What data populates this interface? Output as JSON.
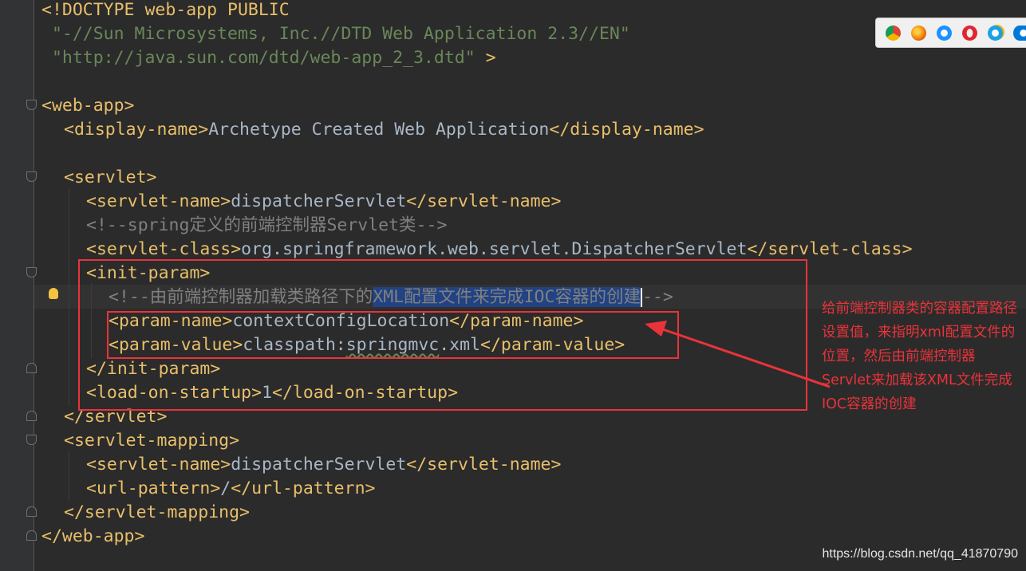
{
  "editor": {
    "lines": [
      {
        "n": 0,
        "indent": 0,
        "parts": [
          {
            "k": "t",
            "v": "<!DOCTYPE web-app PUBLIC"
          }
        ]
      },
      {
        "n": 1,
        "indent": 0,
        "parts": [
          {
            "k": "s",
            "v": " \"-//Sun Microsystems, Inc.//DTD Web Application 2.3//EN\""
          }
        ]
      },
      {
        "n": 2,
        "indent": 0,
        "parts": [
          {
            "k": "s",
            "v": " \"http://java.sun.com/dtd/web-app_2_3.dtd\""
          },
          {
            "k": "t",
            "v": " >"
          }
        ]
      },
      {
        "n": 4,
        "indent": 0,
        "parts": [
          {
            "k": "t",
            "v": "<web-app>"
          }
        ]
      },
      {
        "n": 5,
        "indent": 1,
        "parts": [
          {
            "k": "t",
            "v": "<display-name>"
          },
          {
            "k": "x",
            "v": "Archetype Created Web Application"
          },
          {
            "k": "t",
            "v": "</display-name>"
          }
        ]
      },
      {
        "n": 7,
        "indent": 1,
        "parts": [
          {
            "k": "t",
            "v": "<servlet>"
          }
        ]
      },
      {
        "n": 8,
        "indent": 2,
        "parts": [
          {
            "k": "t",
            "v": "<servlet-name>"
          },
          {
            "k": "x",
            "v": "dispatcherServlet"
          },
          {
            "k": "t",
            "v": "</servlet-name>"
          }
        ]
      },
      {
        "n": 9,
        "indent": 2,
        "parts": [
          {
            "k": "c",
            "v": "<!--spring定义的前端控制器Servlet类-->"
          }
        ]
      },
      {
        "n": 10,
        "indent": 2,
        "parts": [
          {
            "k": "t",
            "v": "<servlet-class>"
          },
          {
            "k": "x",
            "v": "org.springframework.web.servlet.DispatcherServlet"
          },
          {
            "k": "t",
            "v": "</servlet-class>"
          }
        ]
      },
      {
        "n": 11,
        "indent": 2,
        "parts": [
          {
            "k": "t",
            "v": "<init-param>"
          }
        ]
      },
      {
        "n": 12,
        "indent": 3,
        "parts": [
          {
            "k": "c",
            "v": "<!--由前端控制器加载类路径下的"
          },
          {
            "k": "h",
            "v": "XML配置文件来完成IOC容器的创建"
          },
          {
            "k": "caret",
            "v": ""
          },
          {
            "k": "c",
            "v": "-->"
          }
        ]
      },
      {
        "n": 13,
        "indent": 3,
        "parts": [
          {
            "k": "t",
            "v": "<param-name>"
          },
          {
            "k": "x",
            "v": "contextConfigLocation"
          },
          {
            "k": "t",
            "v": "</param-name>"
          }
        ]
      },
      {
        "n": 14,
        "indent": 3,
        "parts": [
          {
            "k": "t",
            "v": "<param-value>"
          },
          {
            "k": "x",
            "v": "classpath:"
          },
          {
            "k": "sq",
            "v": "springmvc"
          },
          {
            "k": "x",
            "v": ".xml"
          },
          {
            "k": "t",
            "v": "</param-value>"
          }
        ]
      },
      {
        "n": 15,
        "indent": 2,
        "parts": [
          {
            "k": "t",
            "v": "</init-param>"
          }
        ]
      },
      {
        "n": 16,
        "indent": 2,
        "parts": [
          {
            "k": "t",
            "v": "<load-on-startup>"
          },
          {
            "k": "x",
            "v": "1"
          },
          {
            "k": "t",
            "v": "</load-on-startup>"
          }
        ]
      },
      {
        "n": 17,
        "indent": 1,
        "parts": [
          {
            "k": "t",
            "v": "</servlet>"
          }
        ]
      },
      {
        "n": 18,
        "indent": 1,
        "parts": [
          {
            "k": "t",
            "v": "<servlet-mapping>"
          }
        ]
      },
      {
        "n": 19,
        "indent": 2,
        "parts": [
          {
            "k": "t",
            "v": "<servlet-name>"
          },
          {
            "k": "x",
            "v": "dispatcherServlet"
          },
          {
            "k": "t",
            "v": "</servlet-name>"
          }
        ]
      },
      {
        "n": 20,
        "indent": 2,
        "parts": [
          {
            "k": "t",
            "v": "<url-pattern>"
          },
          {
            "k": "x",
            "v": "/"
          },
          {
            "k": "t",
            "v": "</url-pattern>"
          }
        ]
      },
      {
        "n": 21,
        "indent": 1,
        "parts": [
          {
            "k": "t",
            "v": "</servlet-mapping>"
          }
        ]
      },
      {
        "n": 22,
        "indent": 0,
        "parts": [
          {
            "k": "t",
            "v": "</web-app>"
          }
        ]
      }
    ]
  },
  "annotation": {
    "text": "给前端控制器类的容器配置路径设置值，来指明xml配置文件的位置，然后由前端控制器Servlet来加载该XML文件完成IOC容器的创建"
  },
  "browser_icons": [
    "chrome-icon",
    "firefox-icon",
    "safari-icon",
    "opera-icon",
    "ie-icon",
    "edge-icon"
  ],
  "watermark": "https://blog.csdn.net/qq_41870790",
  "colors": {
    "background": "#2b2b2b",
    "tag": "#e8bf6a",
    "string": "#6a8759",
    "comment": "#808080",
    "text": "#a9b7c6",
    "selection": "#214283",
    "annotation_red": "#e9333a"
  }
}
